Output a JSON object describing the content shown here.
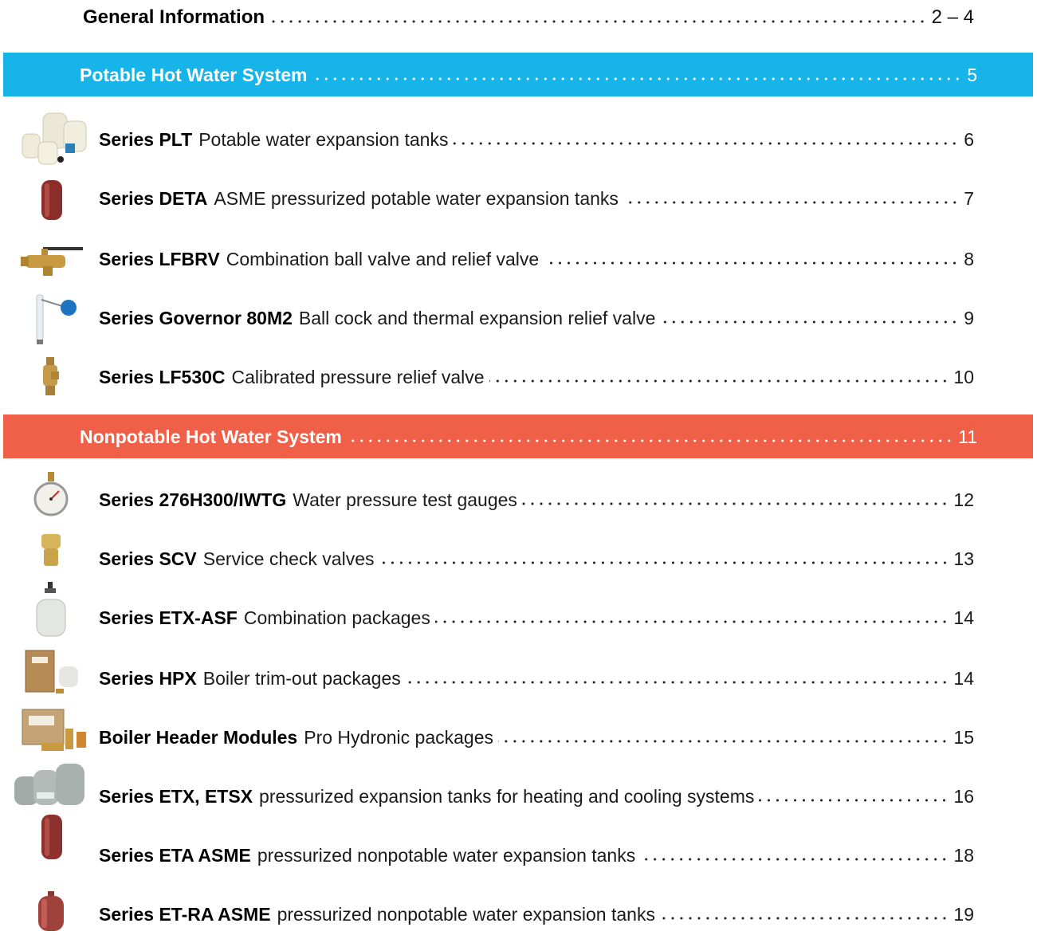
{
  "general": {
    "title": "General Information",
    "page": "2 – 4"
  },
  "sections": [
    {
      "title": "Potable Hot Water System",
      "page": "5",
      "color": "#16b4e8"
    },
    {
      "title": "Nonpotable Hot Water System",
      "page": "11",
      "color": "#f05f48"
    }
  ],
  "potable_entries": [
    {
      "title": "Series PLT",
      "desc": "Potable water expansion tanks",
      "page": "6",
      "icon": "plt-tanks-icon"
    },
    {
      "title": "Series DETA",
      "desc": "ASME pressurized potable water expansion tanks",
      "page": "7",
      "icon": "deta-tank-icon"
    },
    {
      "title": "Series LFBRV",
      "desc": "Combination ball valve and relief valve",
      "page": "8",
      "icon": "ball-valve-icon"
    },
    {
      "title": "Series Governor 80M2",
      "desc": "Ball cock and thermal expansion relief valve",
      "page": "9",
      "icon": "ball-cock-icon"
    },
    {
      "title": "Series LF530C",
      "desc": "Calibrated pressure relief valve",
      "page": "10",
      "icon": "relief-valve-icon"
    }
  ],
  "nonpotable_entries": [
    {
      "title": "Series 276H300/IWTG",
      "desc": "Water pressure test gauges",
      "page": "12",
      "icon": "pressure-gauge-icon"
    },
    {
      "title": "Series SCV",
      "desc": "Service check valves",
      "page": "13",
      "icon": "check-valve-icon"
    },
    {
      "title": "Series ETX-ASF",
      "desc": "Combination packages",
      "page": "14",
      "icon": "etx-asf-package-icon"
    },
    {
      "title": "Series HPX",
      "desc": "Boiler trim-out packages",
      "page": "14",
      "icon": "hpx-package-icon"
    },
    {
      "title": "Boiler Header Modules",
      "desc": "Pro Hydronic packages",
      "page": "15",
      "icon": "header-module-icon"
    },
    {
      "title": "Series ETX, ETSX",
      "desc": "pressurized expansion tanks for heating and cooling systems",
      "page": "16",
      "icon": "etx-tanks-icon"
    },
    {
      "title": "Series ETA ASME",
      "desc": "pressurized nonpotable water expansion tanks",
      "page": "18",
      "icon": "eta-tank-icon"
    },
    {
      "title": "Series ET-RA ASME",
      "desc": "pressurized nonpotable water expansion tanks",
      "page": "19",
      "icon": "et-ra-tank-icon"
    }
  ]
}
